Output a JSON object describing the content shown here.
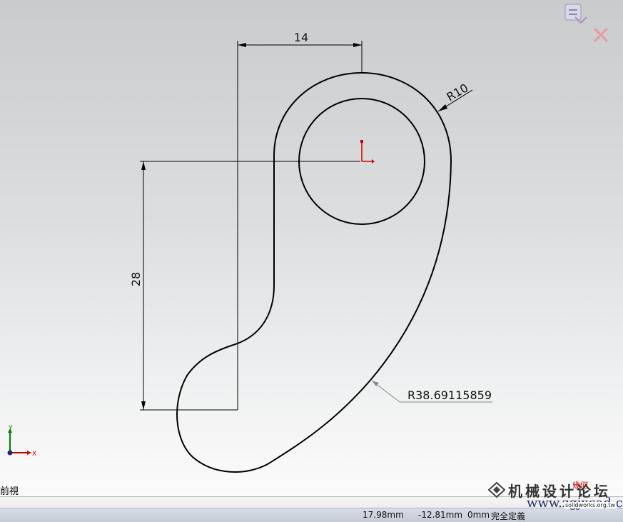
{
  "view": {
    "orientation_label": "前視"
  },
  "dimensions": {
    "horizontal": "14",
    "vertical": "28",
    "radius_small": "R10",
    "radius_large": "R38.69115859"
  },
  "triad": {
    "x_label": "X",
    "y_label": "Y"
  },
  "statusbar": {
    "x_coord": "17.98mm",
    "y_coord": "-12.81mm",
    "z_coord": "0mm",
    "sketch_state": "完全定義"
  },
  "watermark": {
    "chinese_text": "机械设计论坛",
    "url": "www.zgjxcad.com",
    "sub_url": "solidworks.org.tw",
    "badge": "幾何"
  },
  "colors": {
    "geometry": "#000000",
    "origin": "#cc0000",
    "axis_x": "#cc0000",
    "axis_y": "#008000",
    "axis_z": "#1e2a80"
  },
  "icons": [
    "confirm-corner-icon",
    "cancel-corner-icon",
    "origin-icon",
    "view-triad-icon"
  ]
}
